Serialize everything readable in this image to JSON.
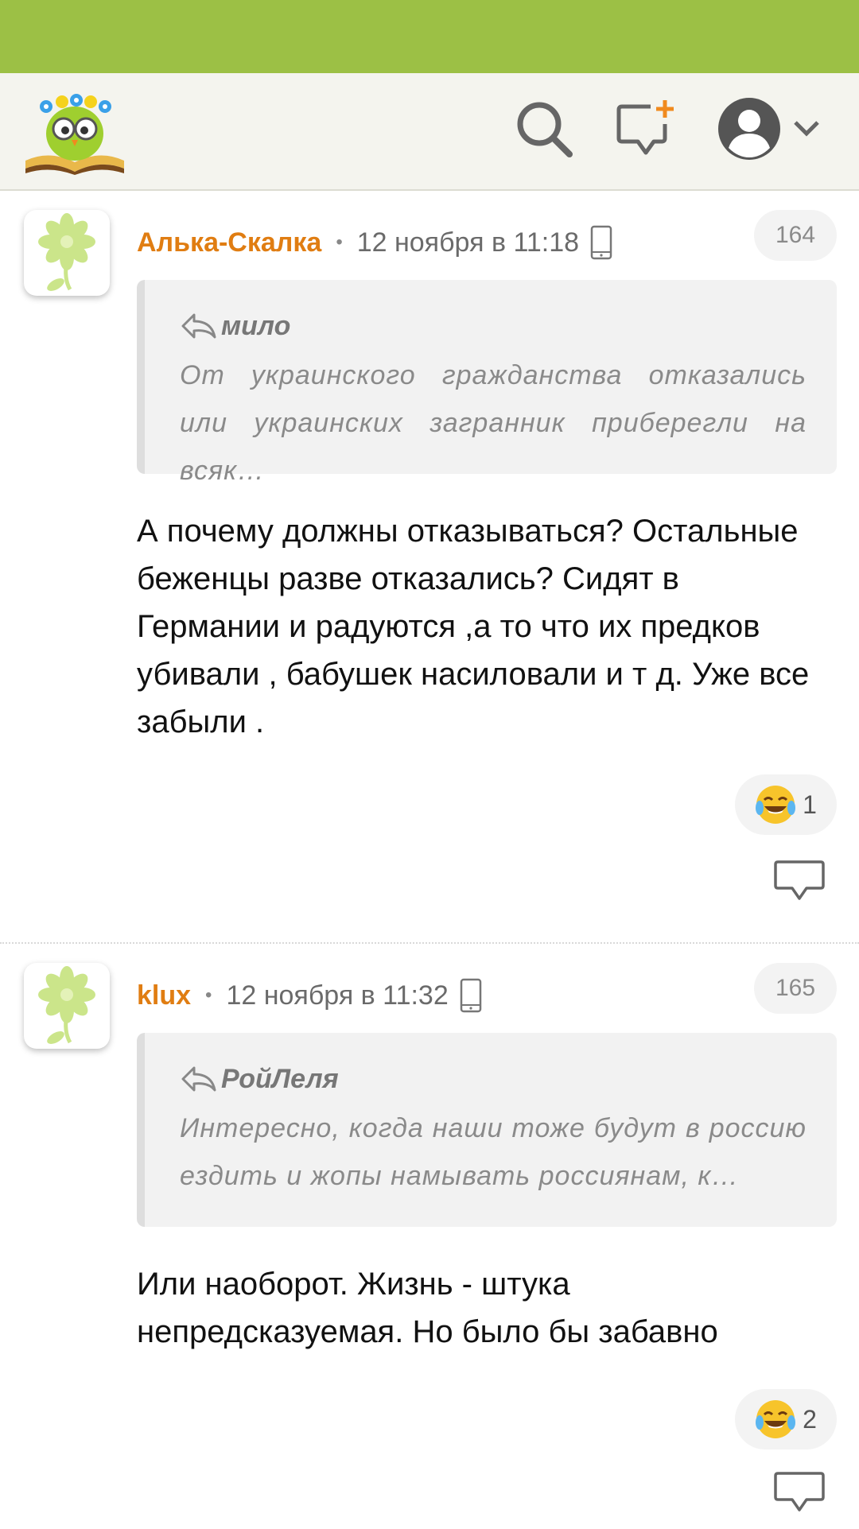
{
  "colors": {
    "statusbar": "#9cc045",
    "topbar": "#f4f4ee",
    "author": "#e07d12",
    "quote_bg": "#f2f2f2"
  },
  "header": {
    "icons": [
      "logo-owl-icon",
      "search-icon",
      "new-post-icon",
      "user-avatar-icon",
      "chevron-down-icon"
    ]
  },
  "comments": [
    {
      "author": "Алька-Скалка",
      "separator": "•",
      "date": "12 ноября в 11:18",
      "number": "164",
      "quote_author": "мило",
      "quote_text": "От украинского гражданства отказались или украинских загранник приберегли на всяк…",
      "text": "А почему должны отказываться? Остальные беженцы разве отказались? Сидят в Германии и радуются ,а то что их предков убивали , бабушек насиловали и т д. Уже все забыли .",
      "reaction_count": "1"
    },
    {
      "author": "klux",
      "separator": "•",
      "date": "12 ноября в 11:32",
      "number": "165",
      "quote_author": "РойЛеля",
      "quote_text": "Интересно, когда наши тоже будут в россию ездить и жопы намывать россиянам, к…",
      "text": "Или наоборот. Жизнь - штука непредсказуемая. Но было бы забавно",
      "reaction_count": "2"
    }
  ]
}
